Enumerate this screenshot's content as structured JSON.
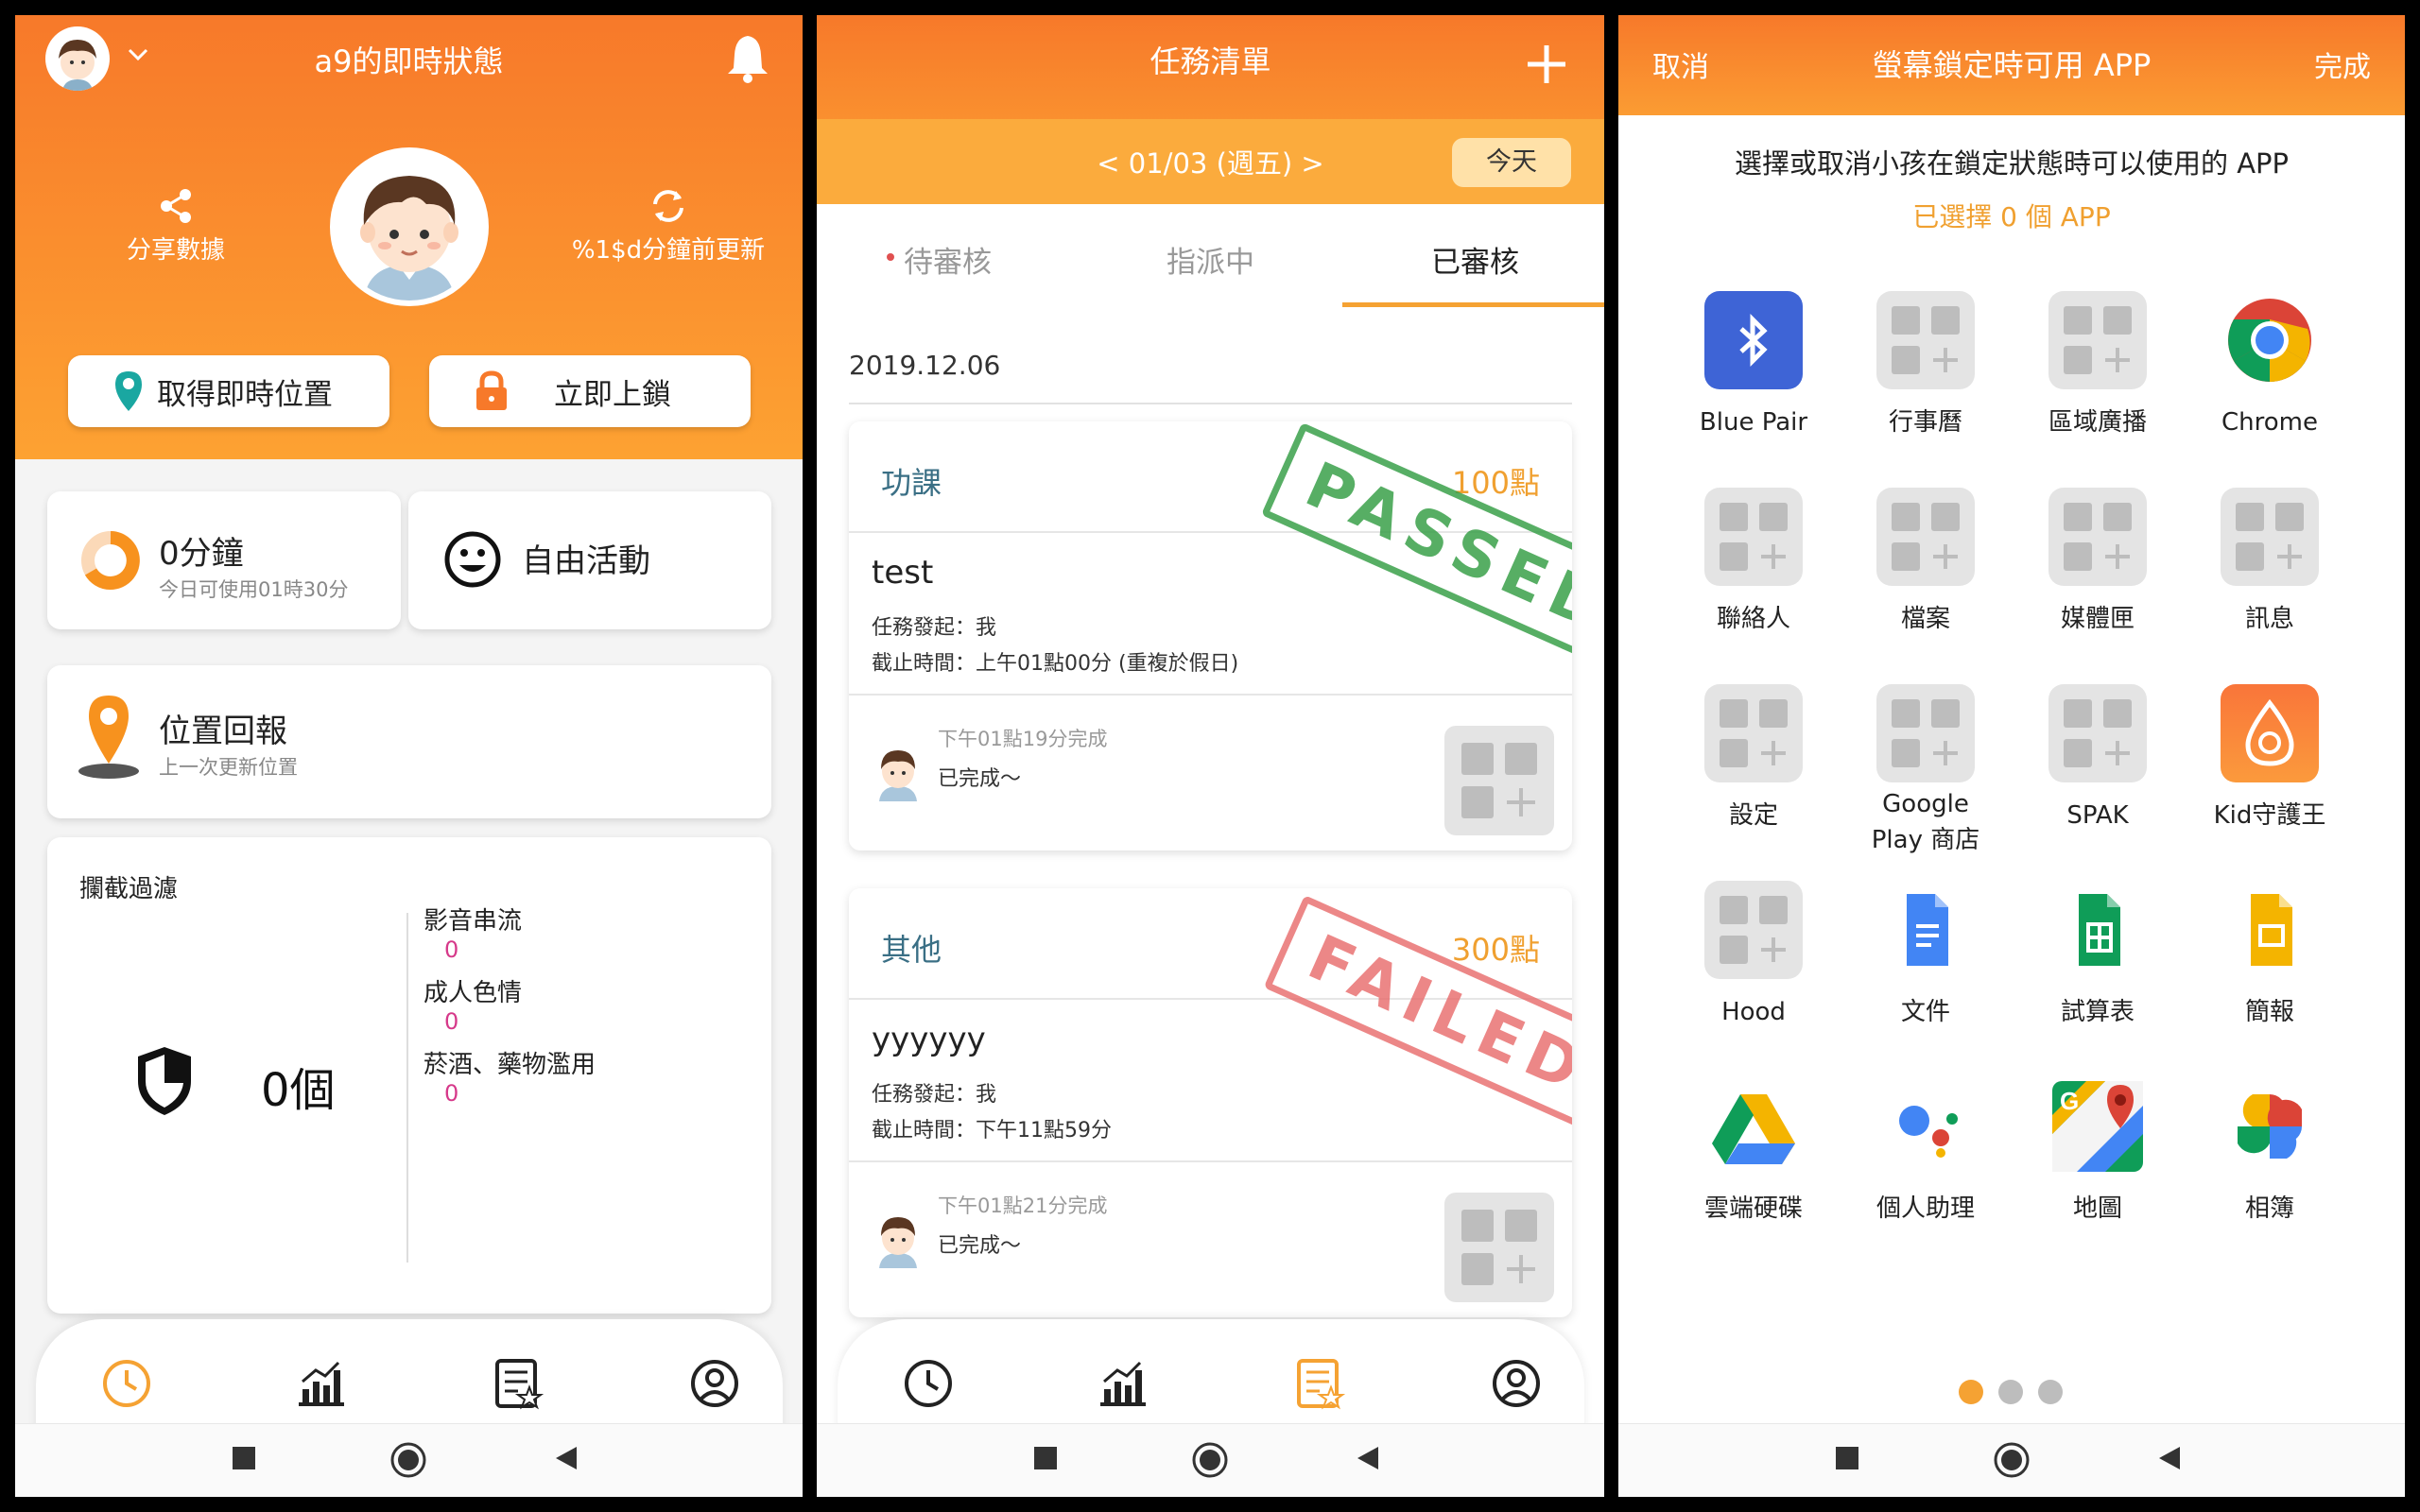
{
  "status_screen": {
    "title": "a9的即時狀態",
    "share_label": "分享數據",
    "update_label": "%1$d分鐘前更新",
    "location_button": "取得即時位置",
    "lock_button": "立即上鎖",
    "usage_value": "0分鐘",
    "usage_sub": "今日可使用01時30分",
    "free_activity": "自由活動",
    "location_report_title": "位置回報",
    "location_report_sub": "上一次更新位置",
    "filter_title": "攔截過濾",
    "filter_count": "0個",
    "filter_items": [
      {
        "label": "影音串流",
        "value": "0"
      },
      {
        "label": "成人色情",
        "value": "0"
      },
      {
        "label": "菸酒、藥物濫用",
        "value": "0"
      }
    ]
  },
  "task_screen": {
    "title": "任務清單",
    "add_icon": "plus-icon",
    "date_nav": "< 01/03 (週五) >",
    "today_button": "今天",
    "tabs": [
      "待審核",
      "指派中",
      "已審核"
    ],
    "active_tab": "已審核",
    "section_date": "2019.12.06",
    "tasks": [
      {
        "category": "功課",
        "points": "100點",
        "name": "test",
        "issuer": "任務發起：我",
        "deadline": "截止時間：上午01點00分 (重複於假日)",
        "completed_time": "下午01點19分完成",
        "note": "已完成～",
        "stamp": "PASSED",
        "stamp_color": "#3aa04a"
      },
      {
        "category": "其他",
        "points": "300點",
        "name": "yyyyyy",
        "issuer": "任務發起：我",
        "deadline": "截止時間：下午11點59分",
        "completed_time": "下午01點21分完成",
        "note": "已完成～",
        "stamp": "FAILED",
        "stamp_color": "#e86a6a"
      }
    ]
  },
  "app_screen": {
    "cancel": "取消",
    "title": "螢幕鎖定時可用 APP",
    "done": "完成",
    "instruction": "選擇或取消小孩在鎖定狀態時可以使用的 APP",
    "selected_count": "已選擇 0 個 APP",
    "apps": [
      {
        "label": "Blue Pair",
        "icon": "bluetooth-icon"
      },
      {
        "label": "行事曆",
        "icon": "placeholder-icon"
      },
      {
        "label": "區域廣播",
        "icon": "placeholder-icon"
      },
      {
        "label": "Chrome",
        "icon": "chrome-icon"
      },
      {
        "label": "聯絡人",
        "icon": "placeholder-icon"
      },
      {
        "label": "檔案",
        "icon": "placeholder-icon"
      },
      {
        "label": "媒體匣",
        "icon": "placeholder-icon"
      },
      {
        "label": "訊息",
        "icon": "placeholder-icon"
      },
      {
        "label": "設定",
        "icon": "placeholder-icon"
      },
      {
        "label": "Google Play 商店",
        "icon": "placeholder-icon"
      },
      {
        "label": "SPAK",
        "icon": "placeholder-icon"
      },
      {
        "label": "Kid守護王",
        "icon": "kid-guard-icon"
      },
      {
        "label": "Hood",
        "icon": "placeholder-icon"
      },
      {
        "label": "文件",
        "icon": "docs-icon"
      },
      {
        "label": "試算表",
        "icon": "sheets-icon"
      },
      {
        "label": "簡報",
        "icon": "slides-icon"
      },
      {
        "label": "雲端硬碟",
        "icon": "drive-icon"
      },
      {
        "label": "個人助理",
        "icon": "assistant-icon"
      },
      {
        "label": "地圖",
        "icon": "maps-icon"
      },
      {
        "label": "相簿",
        "icon": "photos-icon"
      }
    ],
    "page_dots": 3,
    "active_page": 1
  },
  "colors": {
    "accent": "#f7792a",
    "active_icon": "#f5a233",
    "task_title": "#3a6f85",
    "points": "#f0a030",
    "filter_value": "#d6398a"
  }
}
